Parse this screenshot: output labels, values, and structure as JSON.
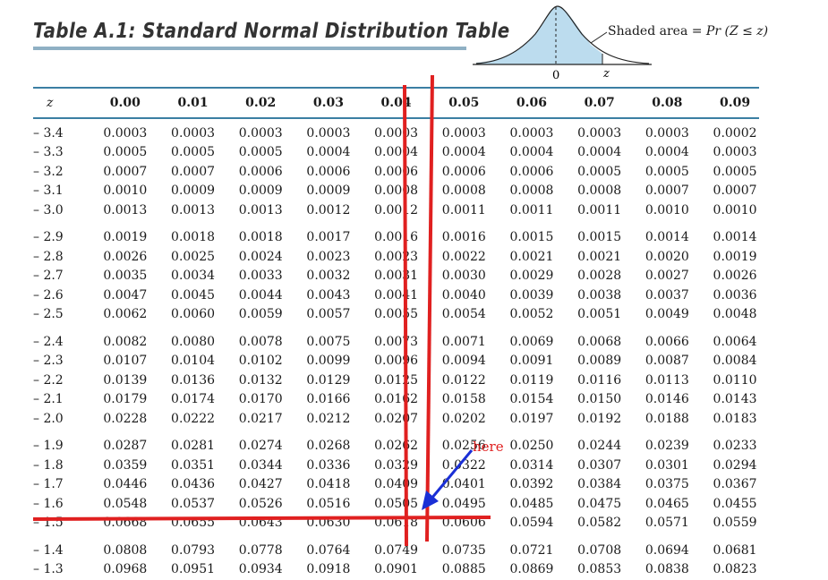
{
  "title": "Table A.1: Standard Normal Distribution Table",
  "figure": {
    "shaded_label_prefix": "Shaded area = ",
    "shaded_label_formula": "Pr (Z ≤ z)",
    "zero_label": "0",
    "z_label": "z"
  },
  "table": {
    "z_header": "z",
    "columns": [
      "0.00",
      "0.01",
      "0.02",
      "0.03",
      "0.04",
      "0.05",
      "0.06",
      "0.07",
      "0.08",
      "0.09"
    ],
    "rows": [
      {
        "z": "– 3.4",
        "v": [
          "0.0003",
          "0.0003",
          "0.0003",
          "0.0003",
          "0.0003",
          "0.0003",
          "0.0003",
          "0.0003",
          "0.0003",
          "0.0002"
        ]
      },
      {
        "z": "– 3.3",
        "v": [
          "0.0005",
          "0.0005",
          "0.0005",
          "0.0004",
          "0.0004",
          "0.0004",
          "0.0004",
          "0.0004",
          "0.0004",
          "0.0003"
        ]
      },
      {
        "z": "– 3.2",
        "v": [
          "0.0007",
          "0.0007",
          "0.0006",
          "0.0006",
          "0.0006",
          "0.0006",
          "0.0006",
          "0.0005",
          "0.0005",
          "0.0005"
        ]
      },
      {
        "z": "– 3.1",
        "v": [
          "0.0010",
          "0.0009",
          "0.0009",
          "0.0009",
          "0.0008",
          "0.0008",
          "0.0008",
          "0.0008",
          "0.0007",
          "0.0007"
        ]
      },
      {
        "z": "– 3.0",
        "v": [
          "0.0013",
          "0.0013",
          "0.0013",
          "0.0012",
          "0.0012",
          "0.0011",
          "0.0011",
          "0.0011",
          "0.0010",
          "0.0010"
        ]
      },
      {
        "z": "– 2.9",
        "v": [
          "0.0019",
          "0.0018",
          "0.0018",
          "0.0017",
          "0.0016",
          "0.0016",
          "0.0015",
          "0.0015",
          "0.0014",
          "0.0014"
        ]
      },
      {
        "z": "– 2.8",
        "v": [
          "0.0026",
          "0.0025",
          "0.0024",
          "0.0023",
          "0.0023",
          "0.0022",
          "0.0021",
          "0.0021",
          "0.0020",
          "0.0019"
        ]
      },
      {
        "z": "– 2.7",
        "v": [
          "0.0035",
          "0.0034",
          "0.0033",
          "0.0032",
          "0.0031",
          "0.0030",
          "0.0029",
          "0.0028",
          "0.0027",
          "0.0026"
        ]
      },
      {
        "z": "– 2.6",
        "v": [
          "0.0047",
          "0.0045",
          "0.0044",
          "0.0043",
          "0.0041",
          "0.0040",
          "0.0039",
          "0.0038",
          "0.0037",
          "0.0036"
        ]
      },
      {
        "z": "– 2.5",
        "v": [
          "0.0062",
          "0.0060",
          "0.0059",
          "0.0057",
          "0.0055",
          "0.0054",
          "0.0052",
          "0.0051",
          "0.0049",
          "0.0048"
        ]
      },
      {
        "z": "– 2.4",
        "v": [
          "0.0082",
          "0.0080",
          "0.0078",
          "0.0075",
          "0.0073",
          "0.0071",
          "0.0069",
          "0.0068",
          "0.0066",
          "0.0064"
        ]
      },
      {
        "z": "– 2.3",
        "v": [
          "0.0107",
          "0.0104",
          "0.0102",
          "0.0099",
          "0.0096",
          "0.0094",
          "0.0091",
          "0.0089",
          "0.0087",
          "0.0084"
        ]
      },
      {
        "z": "– 2.2",
        "v": [
          "0.0139",
          "0.0136",
          "0.0132",
          "0.0129",
          "0.0125",
          "0.0122",
          "0.0119",
          "0.0116",
          "0.0113",
          "0.0110"
        ]
      },
      {
        "z": "– 2.1",
        "v": [
          "0.0179",
          "0.0174",
          "0.0170",
          "0.0166",
          "0.0162",
          "0.0158",
          "0.0154",
          "0.0150",
          "0.0146",
          "0.0143"
        ]
      },
      {
        "z": "– 2.0",
        "v": [
          "0.0228",
          "0.0222",
          "0.0217",
          "0.0212",
          "0.0207",
          "0.0202",
          "0.0197",
          "0.0192",
          "0.0188",
          "0.0183"
        ]
      },
      {
        "z": "– 1.9",
        "v": [
          "0.0287",
          "0.0281",
          "0.0274",
          "0.0268",
          "0.0262",
          "0.0256",
          "0.0250",
          "0.0244",
          "0.0239",
          "0.0233"
        ]
      },
      {
        "z": "– 1.8",
        "v": [
          "0.0359",
          "0.0351",
          "0.0344",
          "0.0336",
          "0.0329",
          "0.0322",
          "0.0314",
          "0.0307",
          "0.0301",
          "0.0294"
        ]
      },
      {
        "z": "– 1.7",
        "v": [
          "0.0446",
          "0.0436",
          "0.0427",
          "0.0418",
          "0.0409",
          "0.0401",
          "0.0392",
          "0.0384",
          "0.0375",
          "0.0367"
        ]
      },
      {
        "z": "– 1.6",
        "v": [
          "0.0548",
          "0.0537",
          "0.0526",
          "0.0516",
          "0.0505",
          "0.0495",
          "0.0485",
          "0.0475",
          "0.0465",
          "0.0455"
        ]
      },
      {
        "z": "– 1.5",
        "v": [
          "0.0668",
          "0.0655",
          "0.0643",
          "0.0630",
          "0.0618",
          "0.0606",
          "0.0594",
          "0.0582",
          "0.0571",
          "0.0559"
        ]
      },
      {
        "z": "– 1.4",
        "v": [
          "0.0808",
          "0.0793",
          "0.0778",
          "0.0764",
          "0.0749",
          "0.0735",
          "0.0721",
          "0.0708",
          "0.0694",
          "0.0681"
        ]
      },
      {
        "z": "– 1.3",
        "v": [
          "0.0968",
          "0.0951",
          "0.0934",
          "0.0918",
          "0.0901",
          "0.0885",
          "0.0869",
          "0.0853",
          "0.0838",
          "0.0823"
        ]
      }
    ]
  },
  "annotation": {
    "here_label": "here",
    "marker_color": "#e02020",
    "arrow_color": "#1a2fd6"
  },
  "colors": {
    "curve_fill": "#bcdcee",
    "rule": "#3b7fa3",
    "title_underline": "#8fb0c4"
  }
}
